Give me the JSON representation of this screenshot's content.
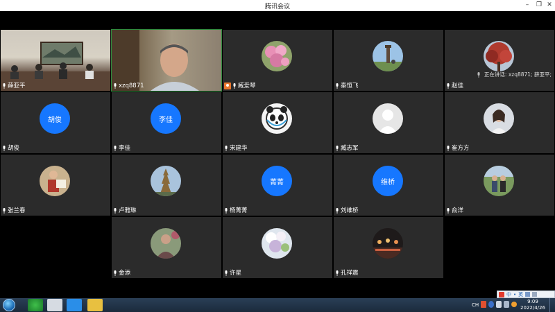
{
  "window": {
    "title": "腾讯会议"
  },
  "speaking_indicator": "正在讲话: xzq8871; 薛亚平;",
  "participants": [
    {
      "name": "薛亚平",
      "type": "video",
      "feed": "group-room"
    },
    {
      "name": "xzq8871",
      "type": "video",
      "feed": "man-closeup",
      "active": true
    },
    {
      "name": "臧爱琴",
      "type": "photo",
      "host": true,
      "photo": "pink-flowers"
    },
    {
      "name": "秦恒飞",
      "type": "photo",
      "photo": "tower-landscape"
    },
    {
      "name": "赵佳",
      "type": "photo",
      "photo": "red-autumn-tree"
    },
    {
      "name": "胡俊",
      "type": "text",
      "avatar_text": "胡俊"
    },
    {
      "name": "李佳",
      "type": "text",
      "avatar_text": "李佳"
    },
    {
      "name": "宋建华",
      "type": "photo",
      "photo": "panda-mascot"
    },
    {
      "name": "臧志军",
      "type": "photo",
      "photo": "default-person"
    },
    {
      "name": "崔方方",
      "type": "photo",
      "photo": "woman-portrait"
    },
    {
      "name": "张兰春",
      "type": "photo",
      "photo": "person-with-sign"
    },
    {
      "name": "卢雅琳",
      "type": "photo",
      "photo": "golden-pagoda"
    },
    {
      "name": "杨菁菁",
      "type": "text",
      "avatar_text": "菁菁"
    },
    {
      "name": "刘维桥",
      "type": "text",
      "avatar_text": "维桥"
    },
    {
      "name": "俞洋",
      "type": "photo",
      "photo": "couple-outdoor"
    },
    {
      "name": "金添",
      "type": "photo",
      "photo": "man-outdoor"
    },
    {
      "name": "许星",
      "type": "photo",
      "photo": "white-blossoms"
    },
    {
      "name": "孔祥震",
      "type": "photo",
      "photo": "night-street"
    }
  ],
  "taskbar": {
    "time": "9:09",
    "date": "2022/4/26",
    "lang": "CH",
    "ime": [
      "中",
      "•",
      "英"
    ]
  },
  "colors": {
    "tile_bg": "#2b2b2b",
    "avatar_blue": "#1677ff",
    "host_badge": "#e8772e"
  }
}
